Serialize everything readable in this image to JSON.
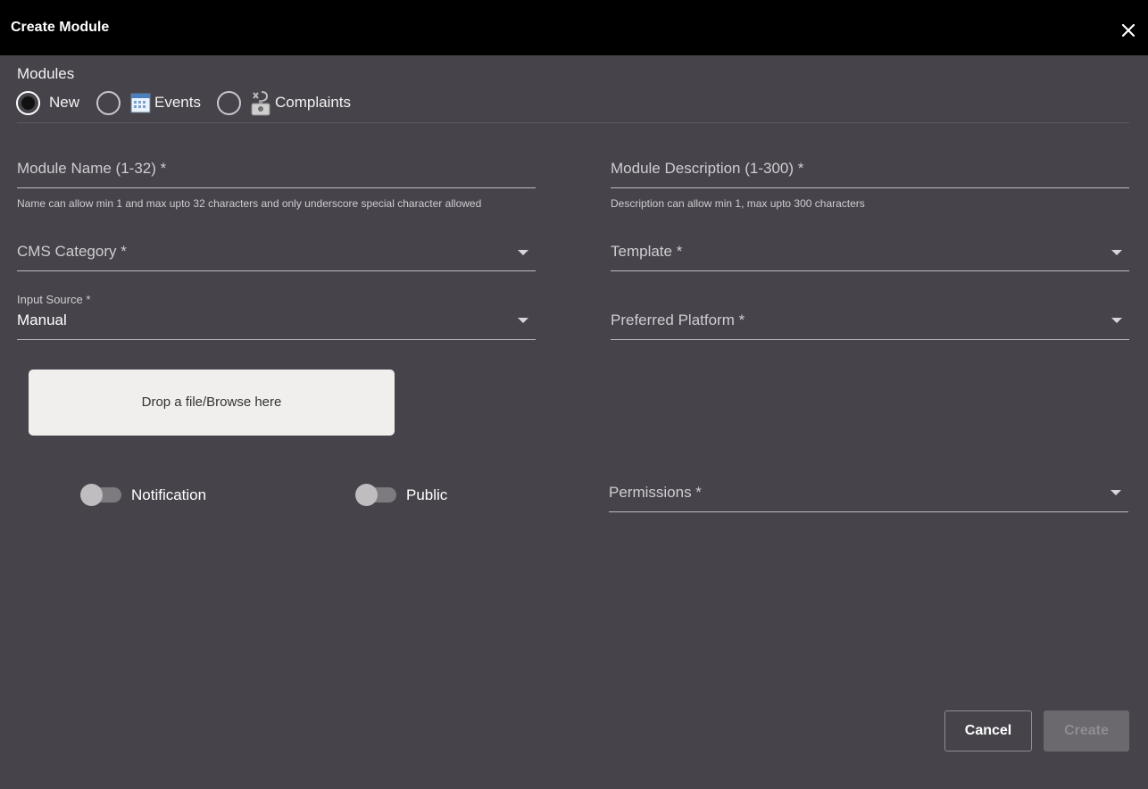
{
  "dialog": {
    "title": "Create Module"
  },
  "modules": {
    "label": "Modules",
    "options": [
      {
        "label": "New",
        "selected": true
      },
      {
        "label": "Events",
        "icon": "calendar-icon",
        "selected": false
      },
      {
        "label": "Complaints",
        "icon": "complaint-icon",
        "selected": false
      }
    ]
  },
  "fields": {
    "module_name": {
      "label": "Module Name (1-32) *",
      "helper": "Name can allow min 1 and max upto 32 characters and only underscore special character allowed"
    },
    "module_description": {
      "label": "Module Description (1-300) *",
      "helper": "Description can allow min 1, max upto 300 characters"
    },
    "cms_category": {
      "label": "CMS Category *"
    },
    "template": {
      "label": "Template *"
    },
    "input_source": {
      "label": "Input Source *",
      "value": "Manual"
    },
    "preferred_platform": {
      "label": "Preferred Platform *"
    },
    "permissions": {
      "label": "Permissions *"
    }
  },
  "dropzone": {
    "text": "Drop a file/Browse here"
  },
  "toggles": {
    "notification": {
      "label": "Notification",
      "on": false
    },
    "public": {
      "label": "Public",
      "on": false
    }
  },
  "buttons": {
    "cancel": "Cancel",
    "create": "Create"
  },
  "colors": {
    "background": "#46434a",
    "titlebar": "#000000",
    "dropzone": "#f0efed",
    "create_disabled": "#6b686e"
  }
}
